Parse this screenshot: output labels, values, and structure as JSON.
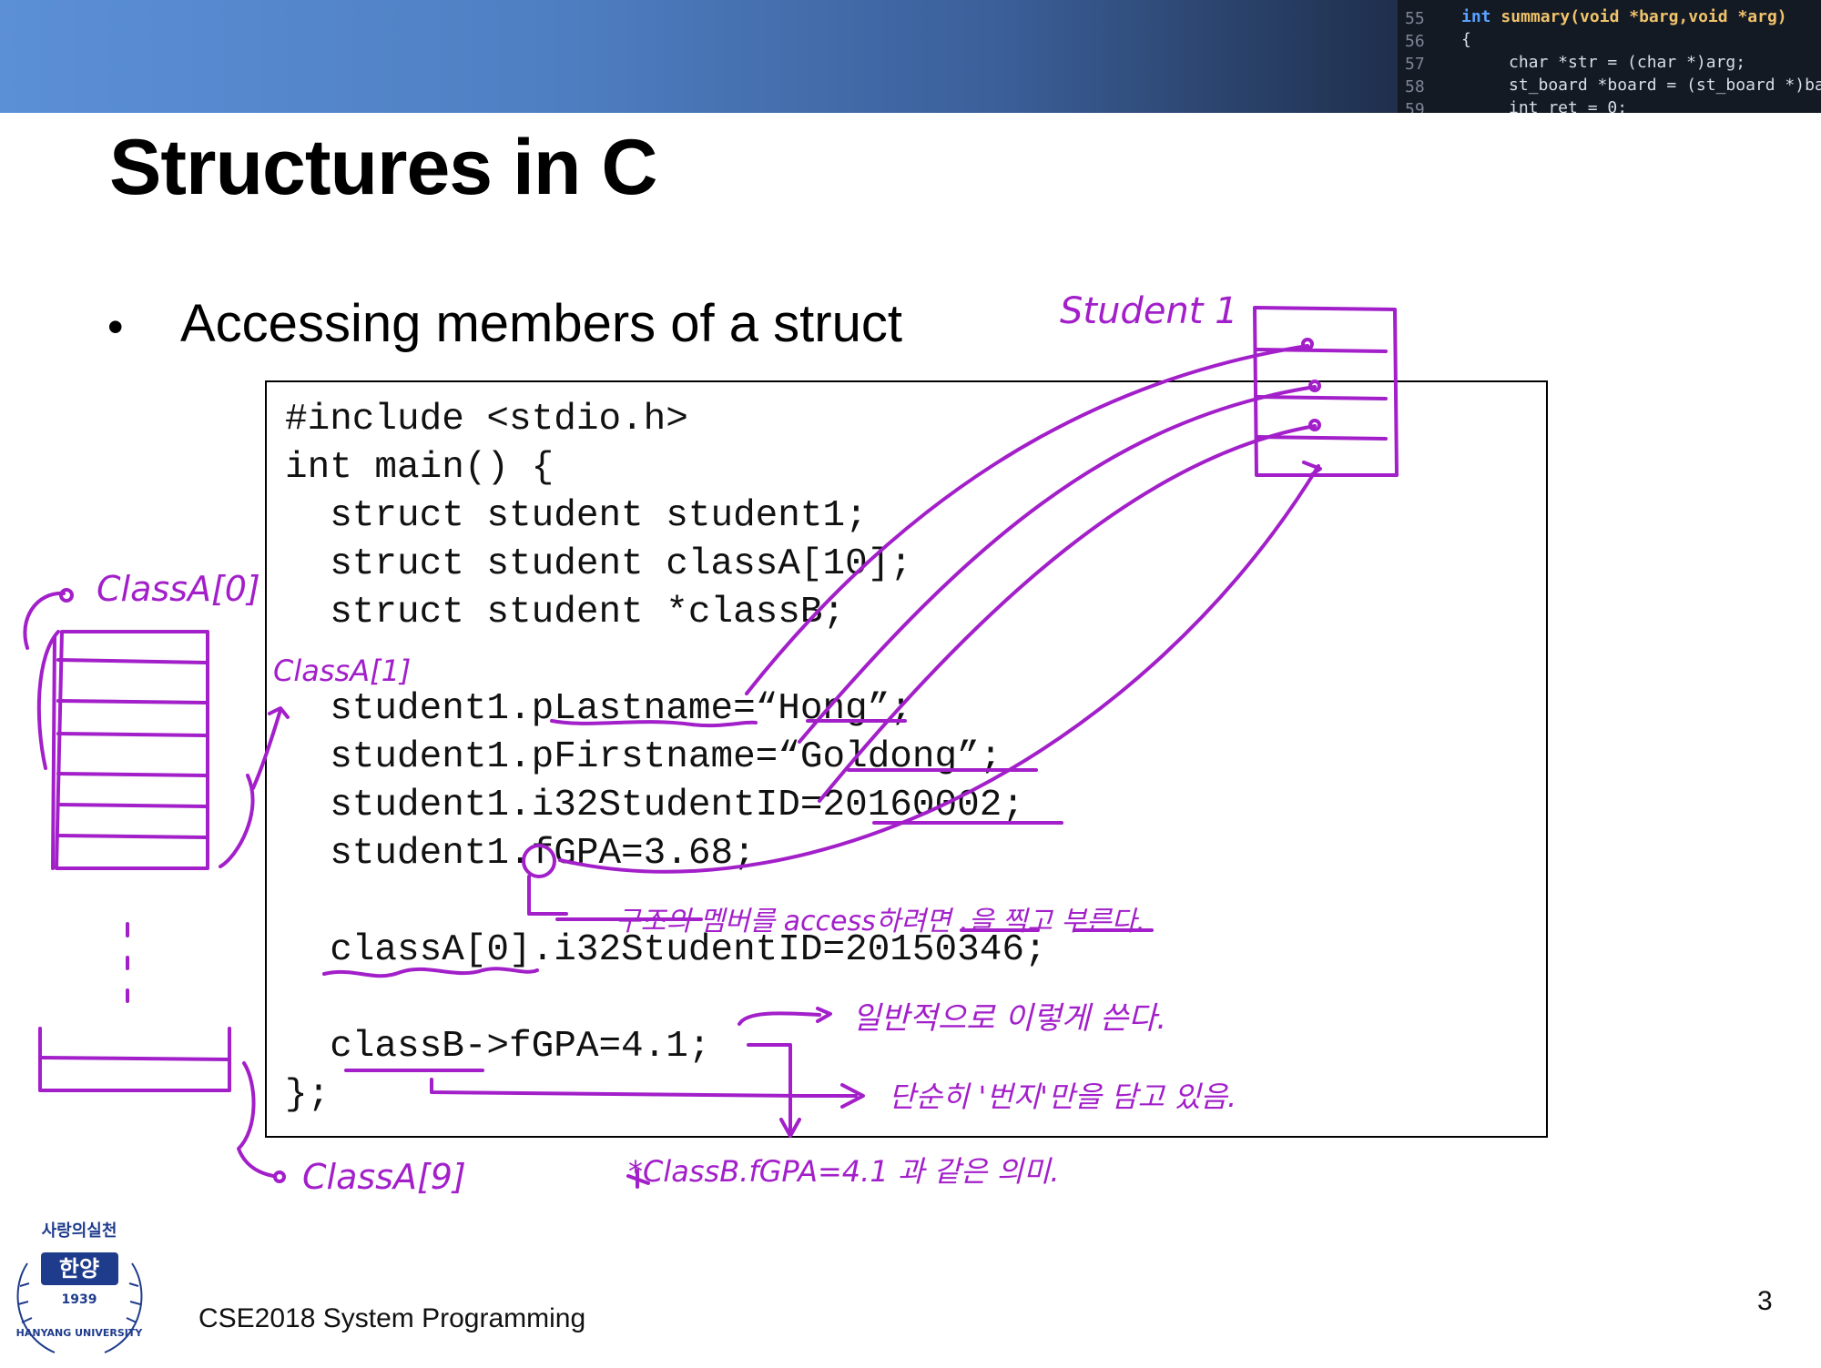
{
  "header": {
    "code_lines": [
      {
        "num": "55",
        "text": "summary(void *barg,void *arg)"
      },
      {
        "num": "56",
        "text": "{"
      },
      {
        "num": "57",
        "text": "char *str = (char *)arg;"
      },
      {
        "num": "58",
        "text": "st_board *board = (st_board *)bar"
      },
      {
        "num": "59",
        "text": "int ret = 0;"
      }
    ]
  },
  "slide": {
    "title": "Structures in C",
    "bullet": "Accessing members of a struct",
    "footer": "CSE2018 System Programming",
    "page_number": "3"
  },
  "code": [
    "#include <stdio.h>",
    "int main() {",
    "  struct student student1;",
    "  struct student classA[10];",
    "  struct student *classB;",
    "",
    "  student1.pLastname=“Hong”;",
    "  student1.pFirstname=“Goldong”;",
    "  student1.i32StudentID=20160002;",
    "  student1.fGPA=3.68;",
    "",
    "  classA[0].i32StudentID=20150346;",
    "",
    "  classB->fGPA=4.1;",
    "};"
  ],
  "annotations": {
    "student1_label": "Student 1",
    "classA0_label": "ClassA[0]",
    "classA1_label": "ClassA[1]",
    "classA9_label": "ClassA[9]",
    "dot_note": "구조의 멤버를 access하려면 .을 찍고 부른다.",
    "arrow_note1": "일반적으로 이렇게 쓴다.",
    "arrow_note2": "단순히 '번지'만을 담고 있음.",
    "pointer_note": "*ClassB.fGPA=4.1 과 같은 의미."
  },
  "logo": {
    "top_text": "사랑의실천",
    "center_text": "한양",
    "year": "1939",
    "ring_text": "HANYANG UNIVERSITY"
  },
  "colors": {
    "ink": "#a21fc9",
    "banner_start": "#5b8fd6",
    "banner_end": "#0d1320",
    "seal_blue": "#1f3c8c"
  }
}
